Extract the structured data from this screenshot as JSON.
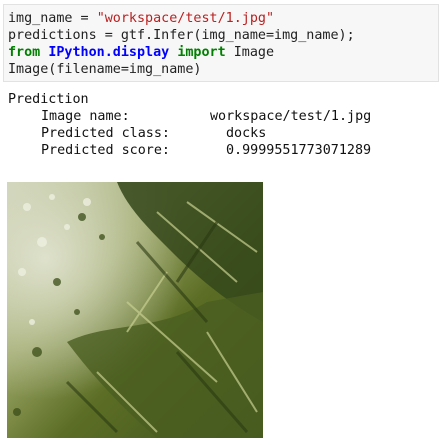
{
  "code_cell": {
    "line1": {
      "var": "img_name",
      "op": " = ",
      "str": "\"workspace/test/1.jpg\""
    },
    "line2": {
      "text": "predictions = gtf.Infer(img_name=img_name);"
    },
    "line3": {
      "kw_from": "from",
      "module": "IPython.display",
      "kw_import": "import",
      "name": "Image"
    },
    "line4": {
      "text": "Image(filename=img_name)"
    }
  },
  "output": {
    "heading": "Prediction",
    "rows": [
      {
        "label": "Image name:",
        "value": "workspace/test/1.jpg"
      },
      {
        "label": "Predicted class:",
        "value": "docks"
      },
      {
        "label": "Predicted score:",
        "value": "0.9999551773071289"
      }
    ]
  },
  "image": {
    "subject": "aerial-foliage-image",
    "colors": {
      "dark": "#34461a",
      "mid": "#6b7d2e",
      "light": "#b8c07e",
      "haze": "#d9dcc0"
    }
  }
}
